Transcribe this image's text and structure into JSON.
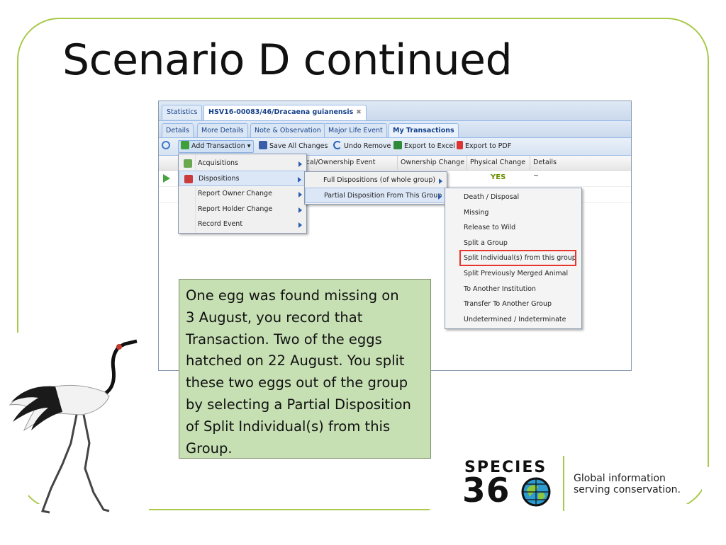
{
  "slide": {
    "title": "Scenario D continued"
  },
  "app": {
    "top_tabs": [
      {
        "label": "Statistics"
      },
      {
        "label": "HSV16-00083/46/Dracaena guianensis",
        "close": "✖"
      }
    ],
    "sub_tabs": [
      {
        "label": "Details"
      },
      {
        "label": "More Details"
      },
      {
        "label": "Note & Observation"
      },
      {
        "label": "Major Life Event"
      },
      {
        "label": "My Transactions"
      }
    ],
    "toolbar": {
      "add_transaction": "Add Transaction",
      "save_all": "Save All Changes",
      "undo_remove": "Undo Remove",
      "export_excel": "Export to Excel",
      "export_pdf": "Export to PDF"
    },
    "grid_headers": [
      "ical/Ownership Event",
      "Ownership Change",
      "Physical Change",
      "Details"
    ],
    "row": {
      "physical_change": "YES",
      "details": "~"
    },
    "menu1": [
      "Acquisitions",
      "Dispositions",
      "Report Owner Change",
      "Report Holder Change",
      "Record Event"
    ],
    "menu2": [
      "Full Dispositions (of whole group)",
      "Partial Disposition From This Group"
    ],
    "menu3": [
      "Death / Disposal",
      "Missing",
      "Release to Wild",
      "Split a Group",
      "Split Individual(s) from this group",
      "Split Previously Merged Animal",
      "To Another Institution",
      "Transfer To Another Group",
      "Undetermined / Indeterminate"
    ]
  },
  "note": {
    "lines": [
      "One egg was found missing on",
      "3 August, you record that",
      "Transaction. Two of the eggs",
      "hatched on 22 August. You split",
      "these two eggs out of the group",
      "by selecting a Partial Disposition",
      "of Split Individual(s) from this",
      "Group."
    ]
  },
  "logo": {
    "word": "SPECIES",
    "number": "36",
    "tagline_1": "Global information",
    "tagline_2": "serving conservation."
  },
  "colors": {
    "frame": "#a9c94a",
    "note_bg": "#c6e0b4",
    "highlight": "#e8342b"
  }
}
